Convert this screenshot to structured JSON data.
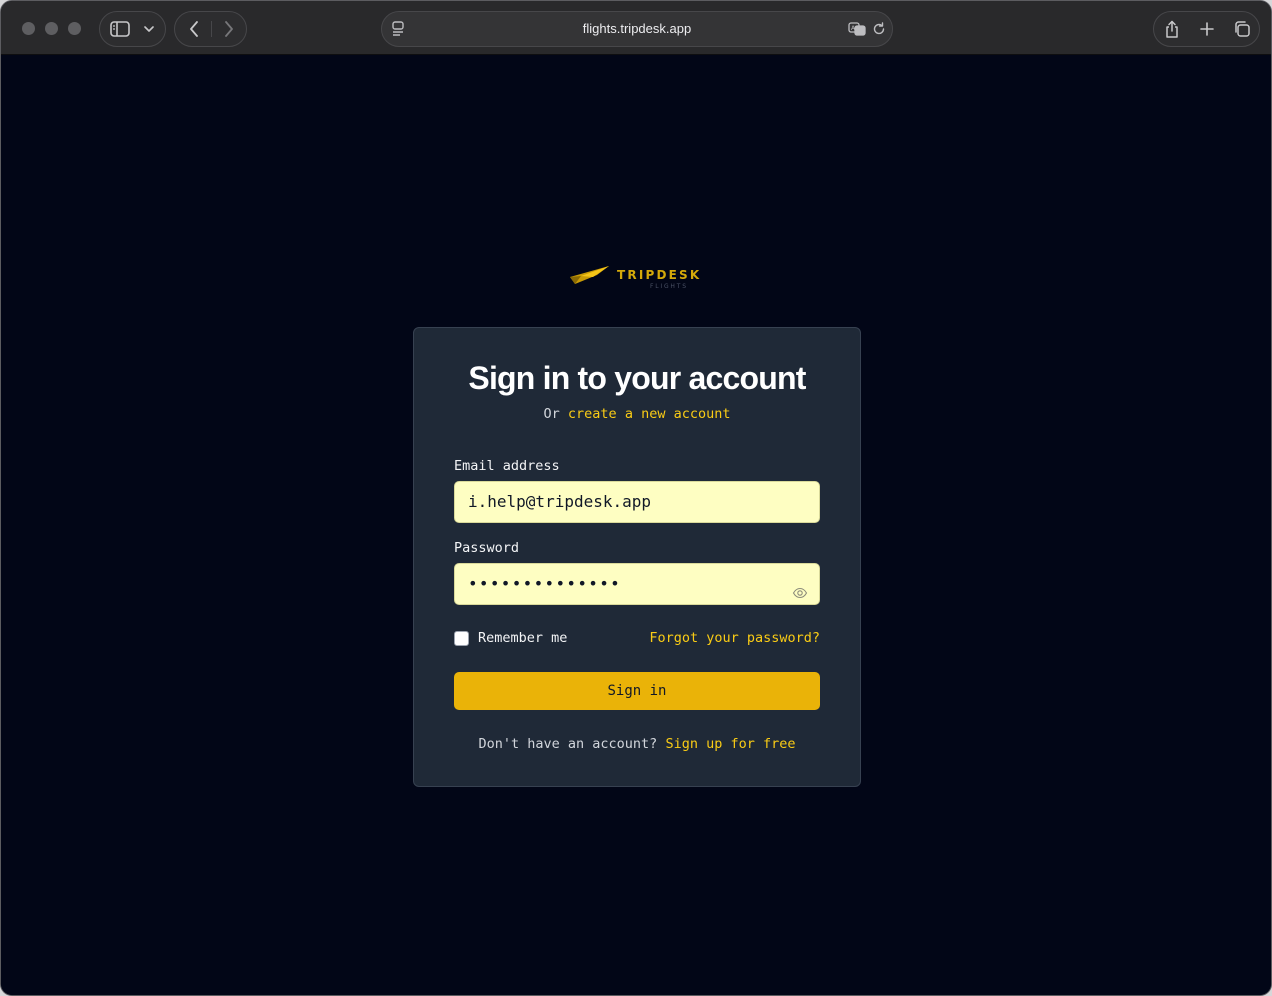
{
  "browser": {
    "url": "flights.tripdesk.app",
    "icons": {
      "sidebar": "sidebar-icon",
      "sidebar_menu": "chevron-down-icon",
      "back": "chevron-left-icon",
      "forward": "chevron-right-icon",
      "page_menu": "page-menu-icon",
      "translate": "translate-icon",
      "reload": "reload-icon",
      "share": "share-icon",
      "new_tab": "plus-icon",
      "tabs": "tab-overview-icon"
    }
  },
  "brand": {
    "name": "TRIPDESK",
    "tagline": "FLIGHTS",
    "accent_color": "#eab308",
    "background_color": "#020617",
    "card_color": "#1f2937",
    "input_color": "#fefec2"
  },
  "signin": {
    "title": "Sign in to your account",
    "subtitle_prefix": "Or",
    "create_link": "create a new account",
    "email_label": "Email address",
    "email_value": "i.help@tripdesk.app",
    "password_label": "Password",
    "password_value": "••••••••••••••",
    "password_toggle_icon": "eye-icon",
    "remember_label": "Remember me",
    "remember_checked": false,
    "forgot_link": "Forgot your password?",
    "submit_label": "Sign in",
    "footer_text": "Don't have an account?",
    "footer_link": "Sign up for free"
  }
}
